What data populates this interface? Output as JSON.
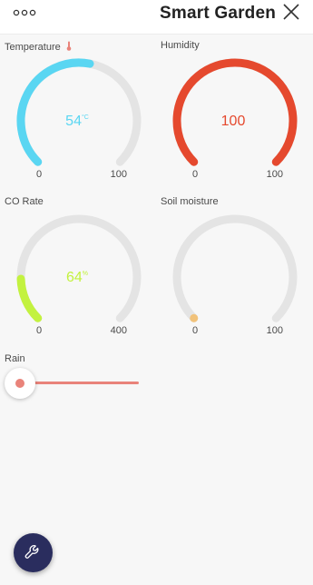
{
  "header": {
    "title": "Smart Garden",
    "menu_icon": "more-horizontal-icon",
    "close_icon": "close-icon"
  },
  "gauges": [
    {
      "label": "Temperature",
      "label_icon": "thermometer-icon",
      "value": "54",
      "unit": "°C",
      "min": "0",
      "max": "100",
      "fraction": 0.54,
      "color": "#5ad6f2",
      "value_color": "#5ad6f2"
    },
    {
      "label": "Humidity",
      "value": "100",
      "unit": "",
      "min": "0",
      "max": "100",
      "fraction": 1.0,
      "color": "#e5492e",
      "value_color": "#e5492e"
    },
    {
      "label": "CO Rate",
      "value": "64",
      "unit": "%",
      "min": "0",
      "max": "400",
      "fraction": 0.16,
      "color": "#c3f23f",
      "value_color": "#c3f23f"
    },
    {
      "label": "Soil moisture",
      "value": "",
      "unit": "",
      "min": "0",
      "max": "100",
      "fraction": 0.0,
      "color": "#f1c27a",
      "value_color": "#f1c27a"
    }
  ],
  "rain": {
    "label": "Rain",
    "level": 0.0,
    "track_color": "#e9837a"
  },
  "fab": {
    "icon": "wrench-icon",
    "color": "#2a2d5e"
  },
  "colors": {
    "track": "#e4e4e4",
    "thermometer": "#e9837a"
  }
}
